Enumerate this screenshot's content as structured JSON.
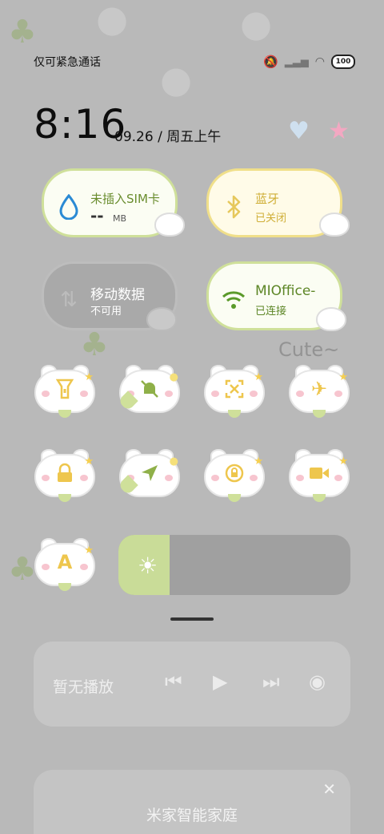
{
  "status": {
    "carrier": "仅可紧急通话",
    "battery": "100"
  },
  "lockscreen": {
    "time": "8:16",
    "date": "09.26 / 周五上午"
  },
  "tiles": {
    "sim": {
      "title": "未插入SIM卡",
      "value": "--",
      "unit": "MB"
    },
    "bluetooth": {
      "title": "蓝牙",
      "status": "已关闭"
    },
    "mobile_data": {
      "title": "移动数据",
      "status": "不可用"
    },
    "wifi": {
      "title": "MIOffice-",
      "status": "已连接"
    }
  },
  "brightness": {
    "level": 0.22
  },
  "media": {
    "text": "暂无播放"
  },
  "smart_home": {
    "title": "米家智能家庭"
  },
  "decor": {
    "cute_text": "Cute~"
  },
  "colors": {
    "accent_green": "#c9dc98",
    "accent_yellow": "#f5cf50",
    "wifi_green": "#5a9a2a",
    "drop_blue": "#2a8ad4"
  },
  "icons": [
    "flashlight-icon",
    "mute-bell-icon",
    "screenshot-icon",
    "airplane-icon",
    "lock-icon",
    "location-icon",
    "rotation-lock-icon",
    "video-record-icon",
    "font-size-icon"
  ]
}
